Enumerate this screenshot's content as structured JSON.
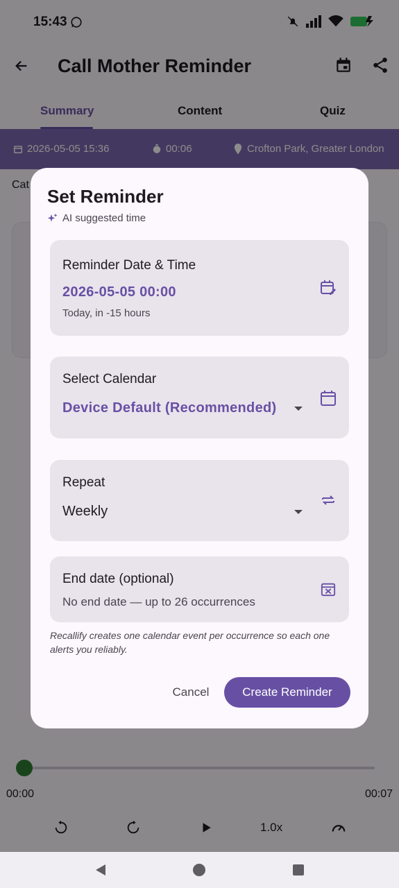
{
  "status_bar": {
    "time": "15:43"
  },
  "app_bar": {
    "title": "Call Mother Reminder"
  },
  "tabs": [
    {
      "label": "Summary",
      "active": true
    },
    {
      "label": "Content",
      "active": false
    },
    {
      "label": "Quiz",
      "active": false
    }
  ],
  "meta": {
    "datetime": "2026-05-05 15:36",
    "duration": "00:06",
    "location": "Crofton Park, Greater London"
  },
  "background": {
    "category_label": "Cat"
  },
  "player": {
    "start_time": "00:00",
    "end_time": "00:07",
    "speed": "1.0x",
    "progress": 0.0
  },
  "dialog": {
    "title": "Set Reminder",
    "ai_hint": "AI suggested time",
    "datetime_section": {
      "label": "Reminder Date & Time",
      "value": "2026-05-05 00:00",
      "sub": "Today, in -15 hours"
    },
    "calendar_section": {
      "label": "Select Calendar",
      "value": "Device Default (Recommended)"
    },
    "repeat_section": {
      "label": "Repeat",
      "value": "Weekly"
    },
    "end_date_section": {
      "label": "End date (optional)",
      "value": "No end date — up to 26 occurrences"
    },
    "note": "Recallify creates one calendar event per occurrence so each one alerts you reliably.",
    "cancel_label": "Cancel",
    "create_label": "Create Reminder"
  },
  "colors": {
    "accent": "#6750a4",
    "meta_bar": "#7b68b0",
    "seek_thumb": "#2e7d32"
  }
}
